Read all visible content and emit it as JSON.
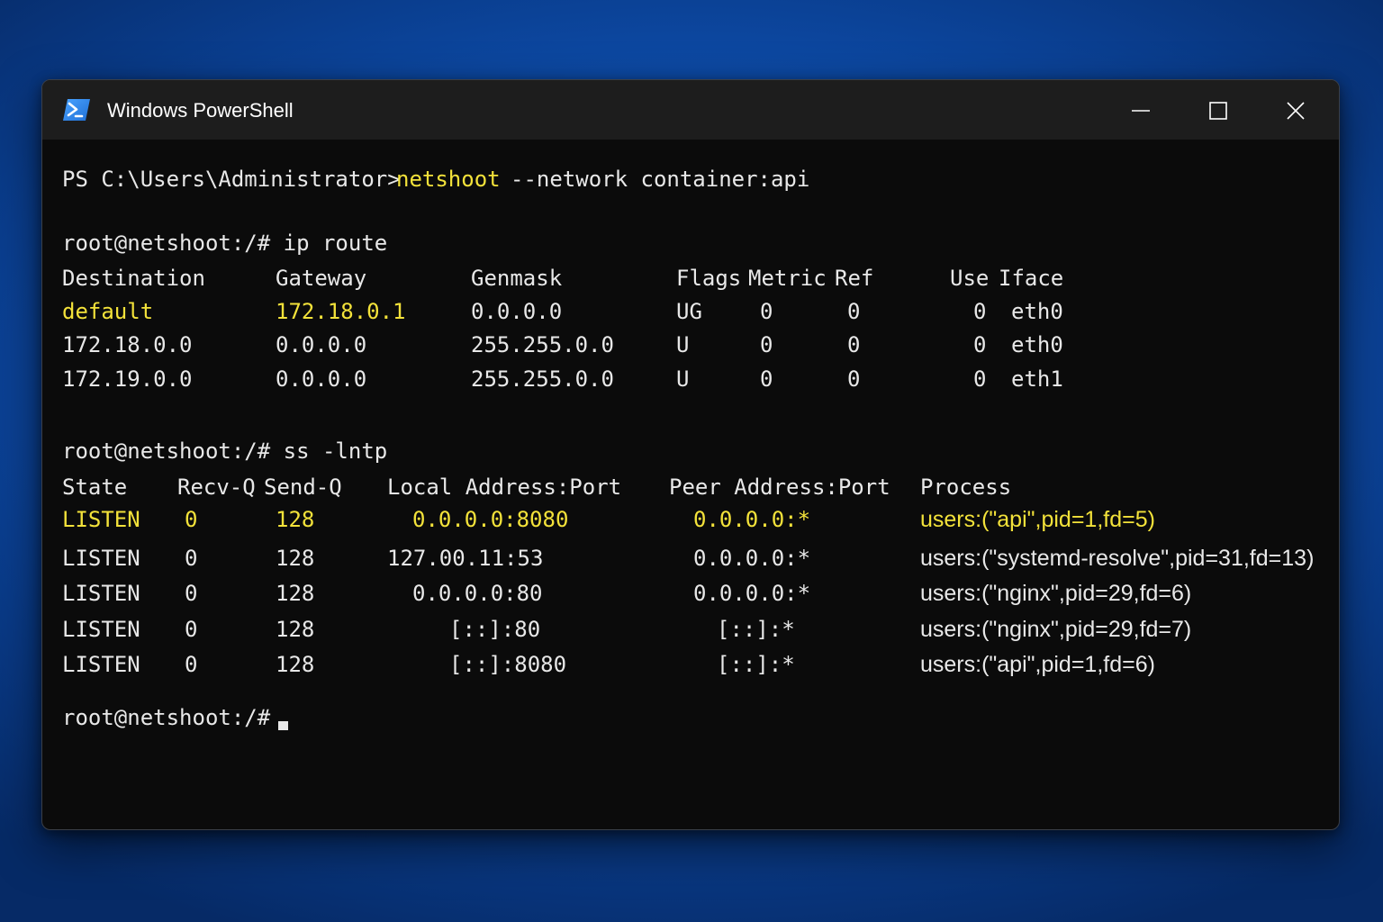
{
  "window": {
    "title": "Windows PowerShell",
    "icon": "powershell-icon"
  },
  "colors": {
    "text": "#e8e8e8",
    "highlight": "#f3e23a",
    "terminal_bg": "#0b0b0b",
    "titlebar_bg": "#1d1d1d"
  },
  "prompt_line": {
    "prefix": "PS C:\\Users\\Administrator>",
    "command": "netshoot",
    "args": "--network container:api"
  },
  "route_section": {
    "prompt": "root@netshoot:/# ip route",
    "headers": [
      "Destination",
      "Gateway",
      "Genmask",
      "Flags",
      "Metric",
      "Ref",
      "Use",
      "Iface"
    ],
    "rows": [
      {
        "destination": "default",
        "gateway": "172.18.0.1",
        "genmask": "0.0.0.0",
        "flags": "UG",
        "metric": "0",
        "ref": "0",
        "use": "0",
        "iface": "eth0"
      },
      {
        "destination": "172.18.0.0",
        "gateway": "0.0.0.0",
        "genmask": "255.255.0.0",
        "flags": "U",
        "metric": "0",
        "ref": "0",
        "use": "0",
        "iface": "eth0"
      },
      {
        "destination": "172.19.0.0",
        "gateway": "0.0.0.0",
        "genmask": "255.255.0.0",
        "flags": "U",
        "metric": "0",
        "ref": "0",
        "use": "0",
        "iface": "eth1"
      }
    ]
  },
  "ss_section": {
    "prompt": "root@netshoot:/# ss -lntp",
    "headers": [
      "State",
      "Recv-Q",
      "Send-Q",
      "Local Address:Port",
      "Peer Address:Port",
      "Process"
    ],
    "rows": [
      {
        "state": "LISTEN",
        "recvq": "0",
        "sendq": "128",
        "local": "0.0.0.0:8080",
        "peer": "0.0.0.0:*",
        "process": "users:(\"api\",pid=1,fd=5)"
      },
      {
        "state": "LISTEN",
        "recvq": "0",
        "sendq": "128",
        "local": "127.00.11:53",
        "peer": "0.0.0.0:*",
        "process": "users:(\"systemd-resolve\",pid=31,fd=13)"
      },
      {
        "state": "LISTEN",
        "recvq": "0",
        "sendq": "128",
        "local": "0.0.0.0:80",
        "peer": "0.0.0.0:*",
        "process": "users:(\"nginx\",pid=29,fd=6)"
      },
      {
        "state": "LISTEN",
        "recvq": "0",
        "sendq": "128",
        "local": "[::]:80",
        "peer": "[::]:*",
        "process": "users:(\"nginx\",pid=29,fd=7)"
      },
      {
        "state": "LISTEN",
        "recvq": "0",
        "sendq": "128",
        "local": "[::]:8080",
        "peer": "[::]:*",
        "process": "users:(\"api\",pid=1,fd=6)"
      }
    ]
  },
  "final_prompt": "root@netshoot:/#"
}
